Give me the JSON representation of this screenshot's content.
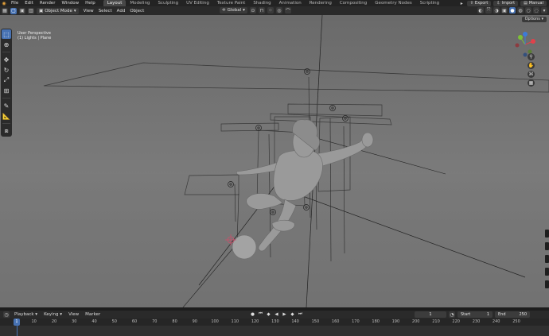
{
  "app": {
    "menus": [
      "File",
      "Edit",
      "Render",
      "Window",
      "Help"
    ],
    "workspaces": [
      "Layout",
      "Modeling",
      "Sculpting",
      "UV Editing",
      "Texture Paint",
      "Shading",
      "Animation",
      "Rendering",
      "Compositing",
      "Geometry Nodes",
      "Scripting"
    ],
    "active_workspace": "Layout",
    "export_label": "Export",
    "import_label": "Import",
    "manual_label": "Manual"
  },
  "viewport_header": {
    "mode": "Object Mode",
    "menus": [
      "View",
      "Select",
      "Add",
      "Object"
    ],
    "transform_orientation": "Global",
    "options_label": "Options"
  },
  "viewport": {
    "view_name": "User Perspective",
    "collection": "(1) Lights | Plane"
  },
  "gizmo": {
    "axes": [
      "X",
      "Y",
      "Z"
    ],
    "colors": {
      "x": "#e0414b",
      "y": "#7ec135",
      "z": "#3d7bd8"
    }
  },
  "timeline": {
    "menus": [
      "Playback",
      "Keying",
      "View",
      "Marker"
    ],
    "current_frame": "1",
    "start_label": "Start",
    "start_value": "1",
    "end_label": "End",
    "end_value": "250",
    "ticks": [
      "1",
      "10",
      "20",
      "30",
      "40",
      "50",
      "60",
      "70",
      "80",
      "90",
      "100",
      "110",
      "120",
      "130",
      "140",
      "150",
      "160",
      "170",
      "180",
      "190",
      "200",
      "210",
      "220",
      "230",
      "240",
      "250"
    ]
  },
  "icons": {
    "tools": [
      "select-box-icon",
      "cursor-icon",
      "move-icon",
      "rotate-icon",
      "scale-icon",
      "transform-icon",
      "annotate-icon",
      "measure-icon",
      "add-cube-icon"
    ],
    "nav": [
      "zoom-icon",
      "pan-icon",
      "camera-view-icon",
      "perspective-icon"
    ]
  }
}
